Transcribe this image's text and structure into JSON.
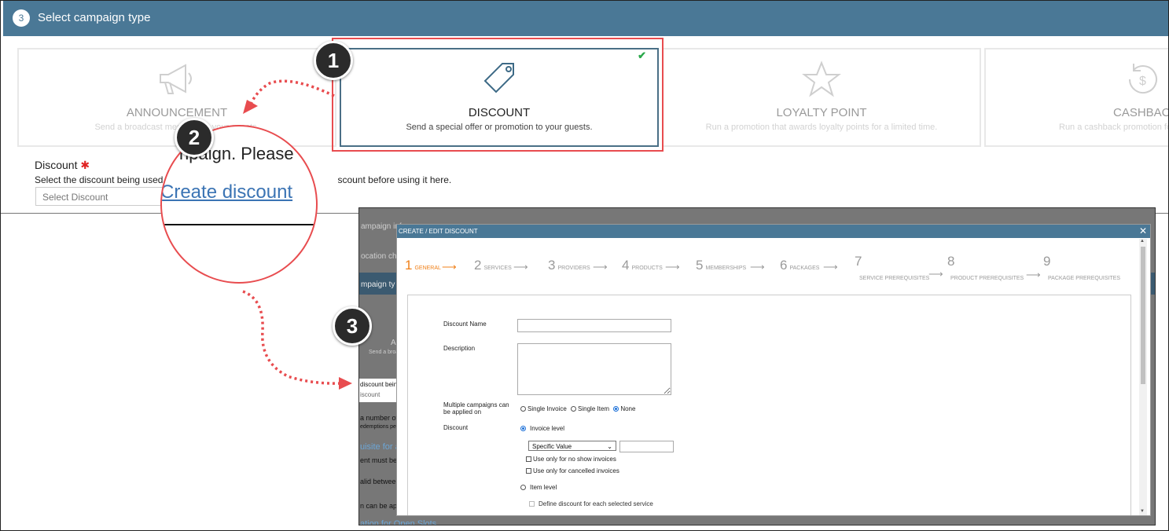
{
  "step": {
    "number": "3",
    "title": "Select campaign type"
  },
  "cards": [
    {
      "title": "ANNOUNCEMENT",
      "desc": "Send a broadcast message to your guests."
    },
    {
      "title": "DISCOUNT",
      "desc": "Send a special offer or promotion to your guests.",
      "selected": true
    },
    {
      "title": "LOYALTY POINT",
      "desc": "Run a promotion that awards loyalty points for a limited time."
    },
    {
      "title": "CASHBACK",
      "desc": "Run a cashback promotion for a limited time."
    }
  ],
  "discount_field": {
    "label": "Discount",
    "required_mark": "✱",
    "help_prefix": "Select the discount being used",
    "help_suffix": "scount before using it here.",
    "placeholder": "Select Discount"
  },
  "magnifier": {
    "text": "npaign. Please",
    "link": "Create discount"
  },
  "callouts": [
    "1",
    "2",
    "3"
  ],
  "behind_page": {
    "items": [
      "ampaign inf",
      "ocation ch",
      "mpaign ty",
      "Al",
      "Send a broa",
      "discount being",
      "iscount",
      "a number of",
      "edemptions pe",
      "uisite for a",
      "ent must be",
      "alid between",
      "n can be app",
      "ation for Open Slots"
    ]
  },
  "modal": {
    "title": "CREATE / EDIT DISCOUNT",
    "close": "✕",
    "wizard": [
      {
        "n": "1",
        "label": "GENERAL"
      },
      {
        "n": "2",
        "label": "SERVICES"
      },
      {
        "n": "3",
        "label": "PROVIDERS"
      },
      {
        "n": "4",
        "label": "PRODUCTS"
      },
      {
        "n": "5",
        "label": "MEMBERSHIPS"
      },
      {
        "n": "6",
        "label": "PACKAGES"
      },
      {
        "n": "7",
        "label": "SERVICE PREREQUISITES"
      },
      {
        "n": "8",
        "label": "PRODUCT PREREQUISITES"
      },
      {
        "n": "9",
        "label": "PACKAGE PREREQUISITES"
      }
    ],
    "form": {
      "discount_name_label": "Discount Name",
      "discount_name_value": "",
      "description_label": "Description",
      "description_value": "",
      "multiple_label_1": "Multiple campaigns can",
      "multiple_label_2": "be applied on",
      "multiple_options": [
        "Single Invoice",
        "Single Item",
        "None"
      ],
      "multiple_selected": "None",
      "discount_label": "Discount",
      "invoice_level": "Invoice level",
      "value_type": "Specific Value",
      "value_amount": "",
      "no_show": "Use only for no show invoices",
      "cancelled": "Use only for cancelled invoices",
      "item_level": "Item level",
      "define_each": "Define discount for each selected service"
    }
  },
  "colors": {
    "header": "#4a7896",
    "accent": "#e84c4f",
    "active_step": "#f08018",
    "check": "#2aa84a"
  }
}
